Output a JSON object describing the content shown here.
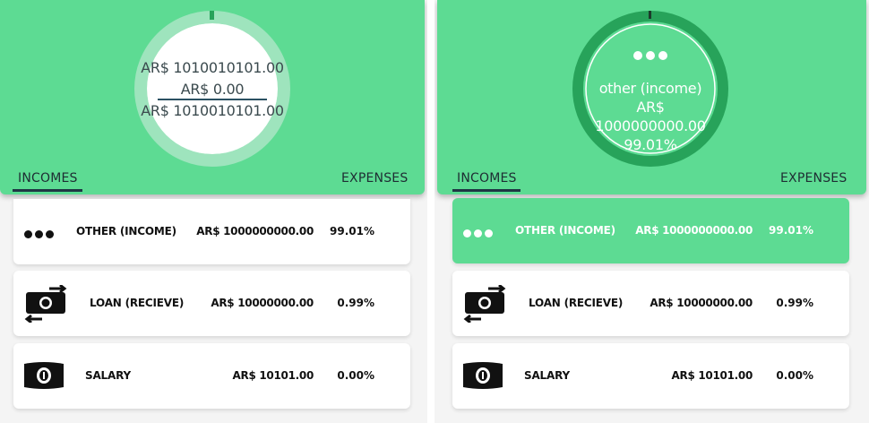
{
  "colors": {
    "header_green": "#5ddb93",
    "ring_dark_green": "#27a35a",
    "ring_light_green": "#9ee4bd",
    "text_dark": "#3b4a4e"
  },
  "left_panel": {
    "donut": {
      "line1": "AR$ 1010010101.00",
      "line2": "AR$ 0.00",
      "line3": "AR$ 1010010101.00"
    },
    "tabs": {
      "incomes": "INCOMES",
      "expenses": "EXPENSES"
    },
    "items": [
      {
        "name": "OTHER (INCOME)",
        "amount": "AR$ 1000000000.00",
        "percent": "99.01%",
        "icon": "three-dots-icon"
      },
      {
        "name": "LOAN (RECIEVE)",
        "amount": "AR$ 10000000.00",
        "percent": "0.99%",
        "icon": "money-exchange-icon"
      },
      {
        "name": "SALARY",
        "amount": "AR$ 10101.00",
        "percent": "0.00%",
        "icon": "banknote-icon"
      }
    ]
  },
  "right_panel": {
    "donut": {
      "selected_name": "other (income)",
      "currency": "AR$",
      "amount": "1000000000.00",
      "percent": "99.01%"
    },
    "tabs": {
      "incomes": "INCOMES",
      "expenses": "EXPENSES"
    },
    "items": [
      {
        "name": "OTHER (INCOME)",
        "amount": "AR$ 1000000000.00",
        "percent": "99.01%",
        "icon": "three-dots-icon",
        "selected": true
      },
      {
        "name": "LOAN (RECIEVE)",
        "amount": "AR$ 10000000.00",
        "percent": "0.99%",
        "icon": "money-exchange-icon"
      },
      {
        "name": "SALARY",
        "amount": "AR$ 10101.00",
        "percent": "0.00%",
        "icon": "banknote-icon"
      }
    ]
  }
}
